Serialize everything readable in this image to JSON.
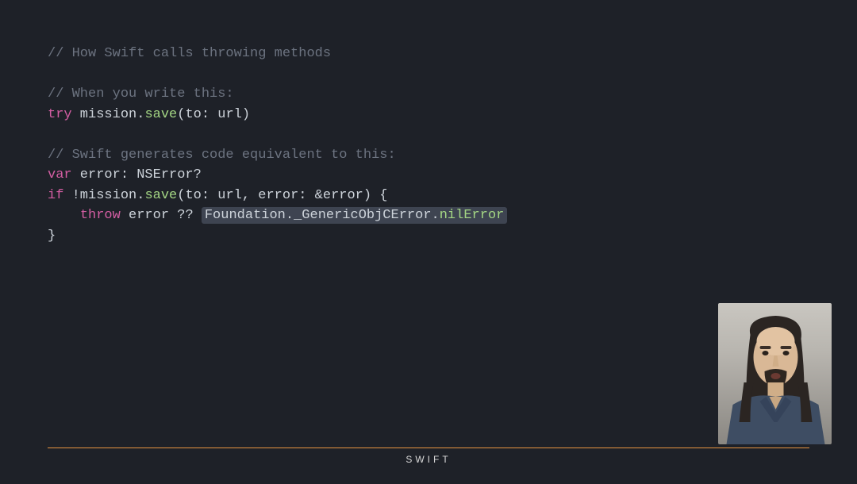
{
  "code": {
    "comment1": "// How Swift calls throwing methods",
    "comment2": "// When you write this:",
    "try_kw": "try",
    "line3_obj": " mission",
    "line3_dot": ".",
    "line3_method": "save",
    "line3_args": "(to: url)",
    "comment3": "// Swift generates code equivalent to this:",
    "var_kw": "var",
    "line6_rest": " error: NSError?",
    "if_kw": "if",
    "line7_obj": " !mission",
    "line7_dot": ".",
    "line7_method": "save",
    "line7_args": "(to: url, error: &error) {",
    "throw_kw": "throw",
    "line8_mid": " error ?? ",
    "hl_module": "Foundation",
    "hl_dot1": ".",
    "hl_type": "_GenericObjCError",
    "hl_dot2": ".",
    "hl_prop": "nilError",
    "line9": "}"
  },
  "footer": {
    "label": "SWIFT"
  }
}
